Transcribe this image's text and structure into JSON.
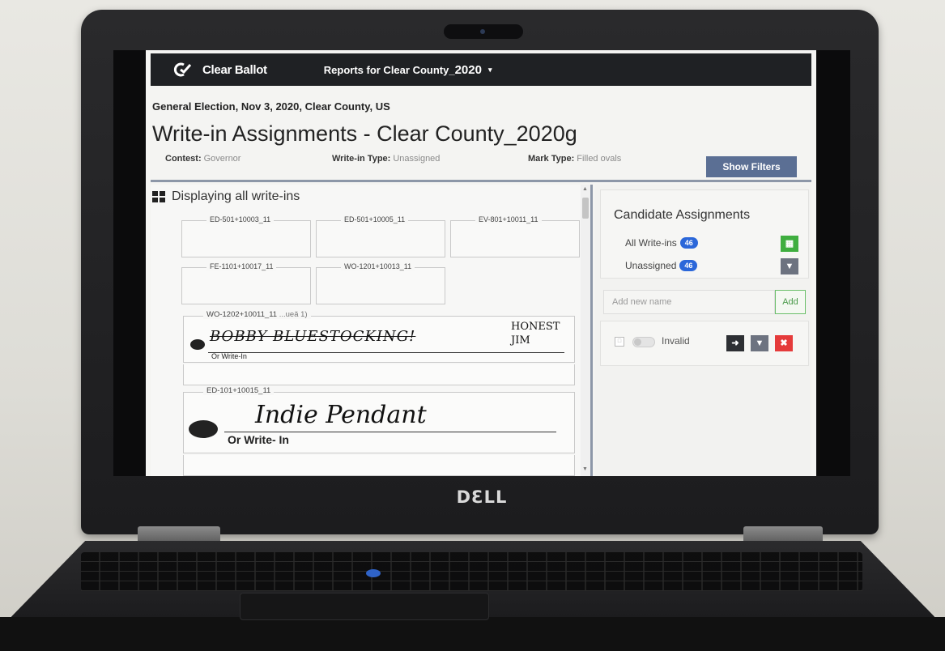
{
  "device": {
    "brand_logo": "DƐLL"
  },
  "app": {
    "brand": "Clear Ballot",
    "report_menu_prefix": "Reports for Clear County_",
    "report_menu_year": "2020",
    "caret": "▾"
  },
  "header": {
    "election": "General Election, Nov 3, 2020, Clear County, US",
    "title": "Write-in Assignments - Clear County_2020g",
    "filters": [
      {
        "label": "Contest:",
        "value": "Governor"
      },
      {
        "label": "Write-in Type:",
        "value": "Unassigned"
      },
      {
        "label": "Mark Type:",
        "value": "Filled ovals"
      }
    ],
    "show_filters_label": "Show Filters"
  },
  "writeins": {
    "heading": "Displaying all write-ins",
    "thumbnails": [
      "ED-501+10003_11",
      "ED-501+10005_11",
      "EV-801+10011_11",
      "FE-1101+10017_11",
      "WO-1201+10013_11"
    ],
    "ballots": [
      {
        "id": "WO-1202+10011_11",
        "fragment": "...ueǎ 1)",
        "or_label": "Or Write-In",
        "hand_struck": "BOBBY BLUESTOCKING!",
        "hand_name": "HONEST JIM"
      },
      {
        "id": "ED-101+10015_11",
        "or_label": "Or Write- In",
        "hand_name": "Indie Pendant"
      }
    ]
  },
  "assignments": {
    "title": "Candidate Assignments",
    "rows": [
      {
        "label": "All Write-ins",
        "count": "46"
      },
      {
        "label": "Unassigned",
        "count": "46"
      }
    ],
    "add_placeholder": "Add new name",
    "add_label": "Add",
    "candidate_label": "Invalid"
  },
  "colors": {
    "topbar": "#1f2124",
    "accent_button": "#5b6f94",
    "badge": "#2b67d9",
    "green": "#3fae3f",
    "red": "#e53b3b"
  }
}
